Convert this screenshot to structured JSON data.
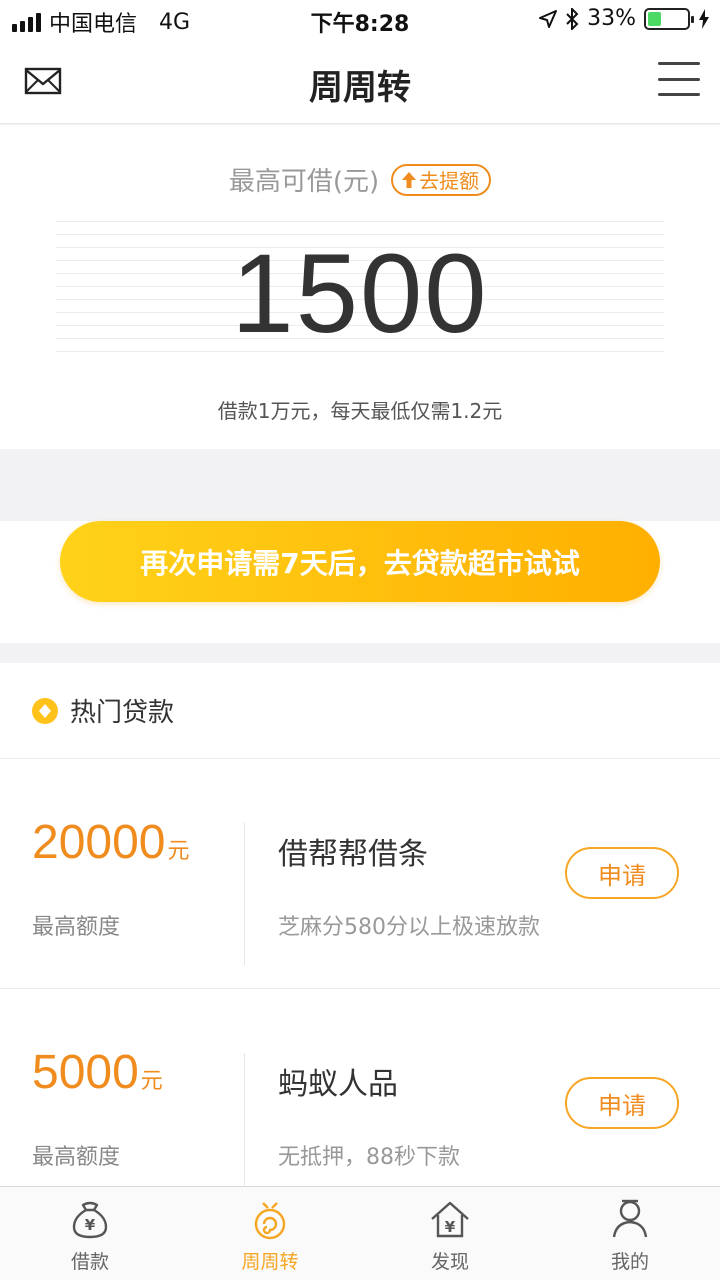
{
  "status_bar": {
    "carrier": "中国电信",
    "network": "4G",
    "time": "下午8:28",
    "battery": "33%",
    "battery_level": 0.33
  },
  "navbar": {
    "title": "周周转",
    "left_icon": "mail-icon",
    "right_icon": "menu-icon"
  },
  "limit": {
    "label": "最高可借(元)",
    "raise_button": "去提额",
    "amount": "1500",
    "note": "借款1万元，每天最低仅需1.2元"
  },
  "apply_button": "再次申请需7天后，去贷款超市试试",
  "hot_loans": {
    "title": "热门贷款",
    "items": [
      {
        "amount": "20000",
        "unit": "元",
        "amount_label": "最高额度",
        "name": "借帮帮借条",
        "desc": "芝麻分580分以上极速放款",
        "apply_label": "申请"
      },
      {
        "amount": "5000",
        "unit": "元",
        "amount_label": "最高额度",
        "name": "蚂蚁人品",
        "desc": "无抵押，88秒下款",
        "apply_label": "申请"
      }
    ]
  },
  "tabbar": {
    "items": [
      {
        "label": "借款",
        "icon": "money-bag-icon"
      },
      {
        "label": "周周转",
        "icon": "turnover-icon",
        "active": true
      },
      {
        "label": "发现",
        "icon": "house-yen-icon"
      },
      {
        "label": "我的",
        "icon": "person-icon"
      }
    ]
  },
  "colors": {
    "accent": "#f08c1e",
    "active_tab": "#f5a623",
    "apply_gradient_start": "#ffd21a",
    "apply_gradient_end": "#ffaf00"
  }
}
